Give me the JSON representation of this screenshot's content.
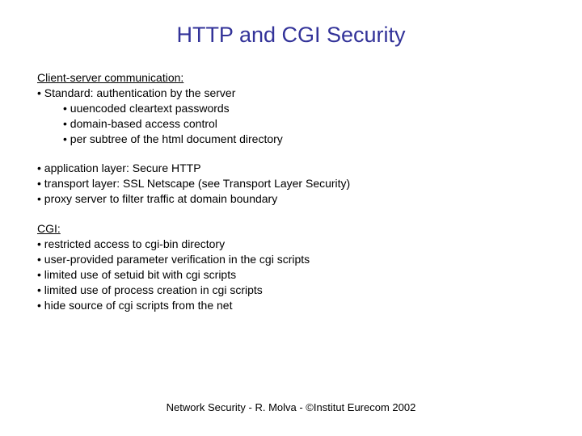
{
  "title": "HTTP and CGI Security",
  "section1": {
    "heading": "Client-server communication:",
    "items": [
      "• Standard: authentication by the server",
      "• uuencoded cleartext passwords",
      "• domain-based access control",
      "• per subtree of the html document directory"
    ]
  },
  "section2": {
    "items": [
      "• application layer: Secure HTTP",
      "• transport layer: SSL Netscape (see Transport Layer Security)",
      "• proxy server to filter traffic at domain boundary"
    ]
  },
  "section3": {
    "heading": "CGI:",
    "items": [
      "• restricted access to cgi-bin directory",
      "• user-provided parameter verification in the cgi scripts",
      "• limited use of setuid bit with cgi scripts",
      "• limited use of process creation in cgi scripts",
      "• hide source of cgi scripts from the net"
    ]
  },
  "footer": "Network Security - R. Molva - ©Institut Eurecom 2002"
}
